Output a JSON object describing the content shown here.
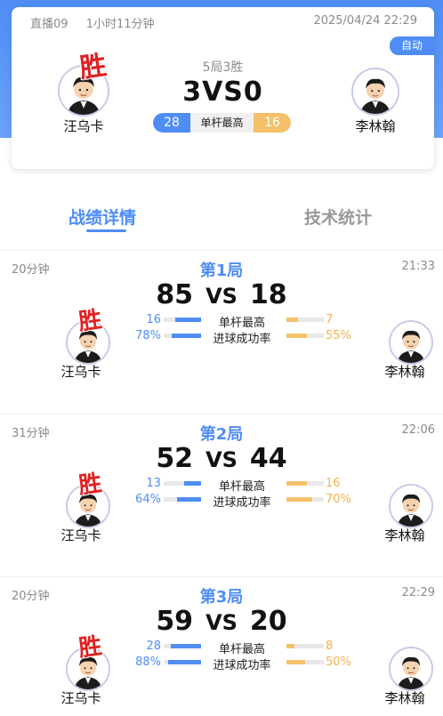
{
  "header": {
    "room": "直播09",
    "duration": "1小时11分钟",
    "datetime": "2025/04/24 22:29",
    "auto_label": "自动",
    "format": "5局3胜",
    "score_left": "3",
    "vs": "VS",
    "score_right": "0",
    "winner_mark": "胜",
    "player_left": "汪乌卡",
    "player_right": "李林翰",
    "highbreak_label": "单杆最高",
    "highbreak_left": "28",
    "highbreak_right": "16"
  },
  "tabs": [
    {
      "label": "战绩详情"
    },
    {
      "label": "技术统计"
    }
  ],
  "colors": {
    "accent": "#4f8df5",
    "accent_right": "#f5c06a",
    "winner": "#e02020"
  },
  "frames": [
    {
      "duration": "20分钟",
      "title": "第1局",
      "end_time": "21:33",
      "score_left": "85",
      "vs": "VS",
      "score_right": "18",
      "winner_mark": "胜",
      "player_left": "汪乌卡",
      "player_right": "李林翰",
      "stats": [
        {
          "label": "单杆最高",
          "left": "16",
          "right": "7",
          "left_pct": 0.7,
          "right_pct": 0.3
        },
        {
          "label": "进球成功率",
          "left": "78%",
          "right": "55%",
          "left_pct": 0.78,
          "right_pct": 0.55
        }
      ]
    },
    {
      "duration": "31分钟",
      "title": "第2局",
      "end_time": "22:06",
      "score_left": "52",
      "vs": "VS",
      "score_right": "44",
      "winner_mark": "胜",
      "player_left": "汪乌卡",
      "player_right": "李林翰",
      "stats": [
        {
          "label": "单杆最高",
          "left": "13",
          "right": "16",
          "left_pct": 0.45,
          "right_pct": 0.55
        },
        {
          "label": "进球成功率",
          "left": "64%",
          "right": "70%",
          "left_pct": 0.64,
          "right_pct": 0.7
        }
      ]
    },
    {
      "duration": "20分钟",
      "title": "第3局",
      "end_time": "22:29",
      "score_left": "59",
      "vs": "VS",
      "score_right": "20",
      "winner_mark": "胜",
      "player_left": "汪乌卡",
      "player_right": "李林翰",
      "stats": [
        {
          "label": "单杆最高",
          "left": "28",
          "right": "8",
          "left_pct": 0.8,
          "right_pct": 0.22
        },
        {
          "label": "进球成功率",
          "left": "88%",
          "right": "50%",
          "left_pct": 0.88,
          "right_pct": 0.5
        }
      ]
    }
  ]
}
